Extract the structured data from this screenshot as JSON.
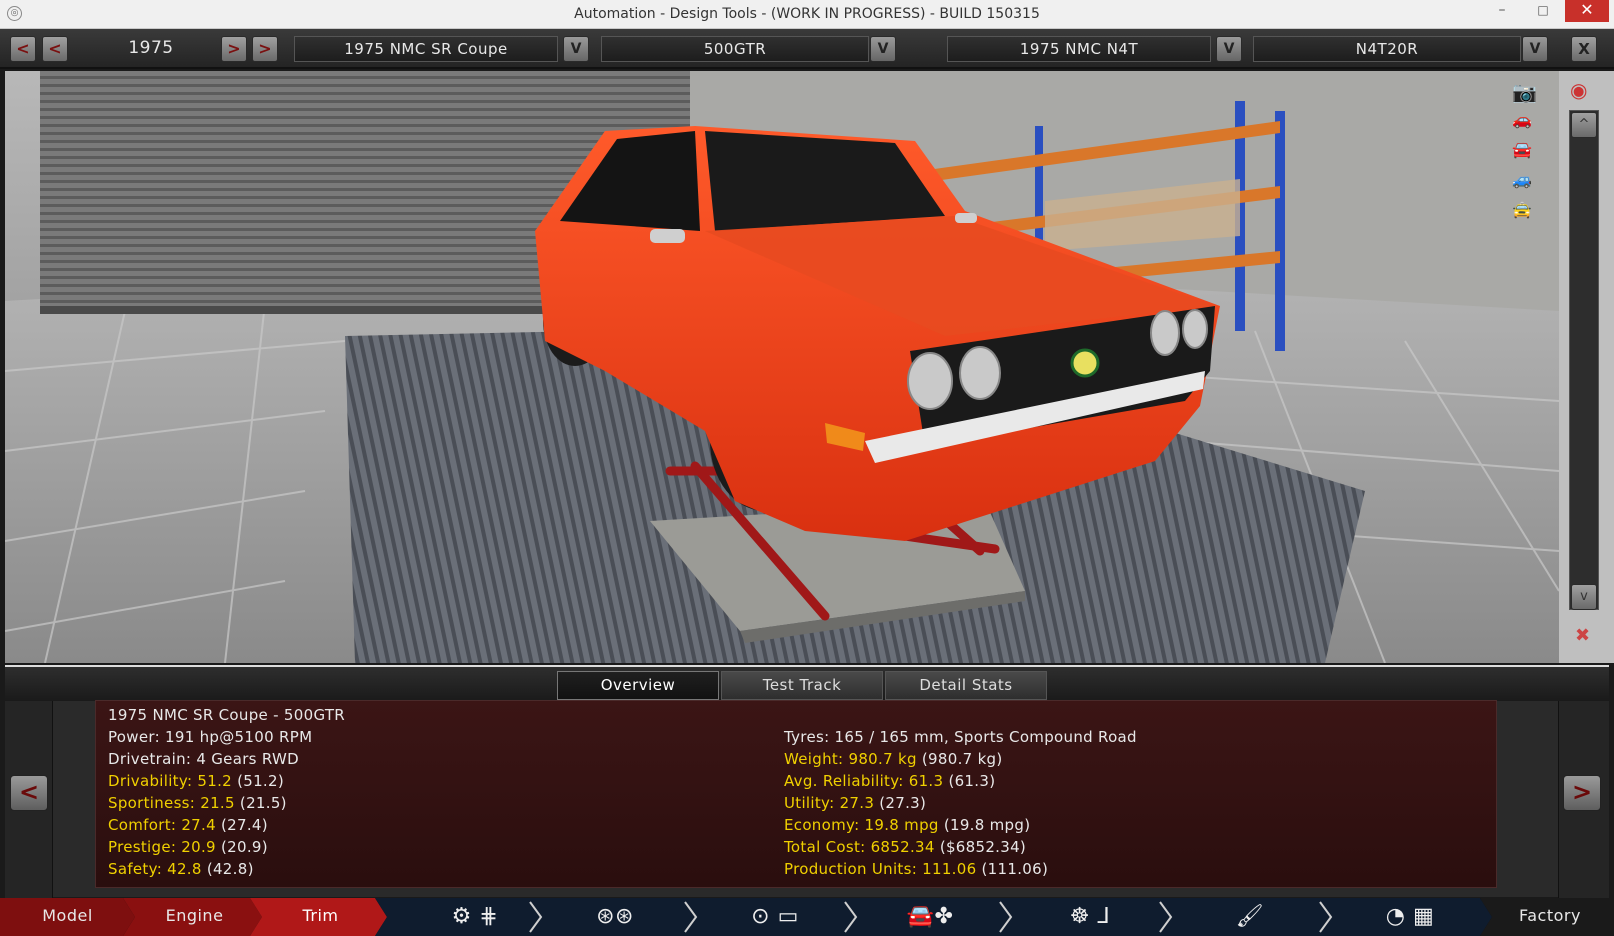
{
  "window": {
    "title": "Automation - Design Tools - (WORK IN PROGRESS) - BUILD 150315",
    "minimize": "–",
    "maximize": "□",
    "close": "✕"
  },
  "topbar": {
    "year_prev_fast": "<",
    "year_prev": "<",
    "year": "1975",
    "year_next": ">",
    "year_next_fast": ">",
    "model_name": "1975 NMC SR Coupe",
    "trim_name": "500GTR",
    "engine_family": "1975 NMC N4T",
    "engine_variant": "N4T20R",
    "dropdown_glyph": "V",
    "close_glyph": "X"
  },
  "viewport": {
    "scroll_up": "^",
    "scroll_down": "v",
    "body_color": "#e8401e"
  },
  "panel": {
    "tabs": [
      "Overview",
      "Test Track",
      "Detail Stats"
    ],
    "active_tab": "Overview",
    "prev": "<",
    "next": ">",
    "header": "1975 NMC SR Coupe - 500GTR",
    "left": [
      {
        "label": "Power:",
        "value": "191 hp@5100 RPM",
        "color": "white"
      },
      {
        "label": "Drivetrain:",
        "value": "4 Gears RWD",
        "color": "white"
      },
      {
        "label": "Drivability:",
        "value": "51.2",
        "ref": "(51.2)",
        "color": "yellow"
      },
      {
        "label": "Sportiness:",
        "value": "21.5",
        "ref": "(21.5)",
        "color": "yellow"
      },
      {
        "label": "Comfort:",
        "value": "27.4",
        "ref": "(27.4)",
        "color": "yellow"
      },
      {
        "label": "Prestige:",
        "value": "20.9",
        "ref": "(20.9)",
        "color": "yellow"
      },
      {
        "label": "Safety:",
        "value": "42.8",
        "ref": "(42.8)",
        "color": "yellow"
      }
    ],
    "right": [
      {
        "label": "Tyres:",
        "value": "165 / 165 mm, Sports Compound Road",
        "color": "white"
      },
      {
        "label": "Weight:",
        "value": "980.7 kg",
        "ref": "(980.7 kg)",
        "color": "yellow"
      },
      {
        "label": "Avg. Reliability:",
        "value": "61.3",
        "ref": "(61.3)",
        "color": "yellow"
      },
      {
        "label": "Utility:",
        "value": "27.3",
        "ref": "(27.3)",
        "color": "yellow"
      },
      {
        "label": "Economy:",
        "value": "19.8 mpg",
        "ref": "(19.8 mpg)",
        "color": "yellow"
      },
      {
        "label": "Total Cost:",
        "value": "6852.34",
        "ref": "($6852.34)",
        "color": "yellow"
      },
      {
        "label": "Production Units:",
        "value": "111.06",
        "ref": "(111.06)",
        "color": "yellow"
      }
    ]
  },
  "bottom_nav": {
    "model": "Model",
    "engine": "Engine",
    "trim": "Trim",
    "factory": "Factory",
    "active": "Trim",
    "accent": "#b01818"
  }
}
